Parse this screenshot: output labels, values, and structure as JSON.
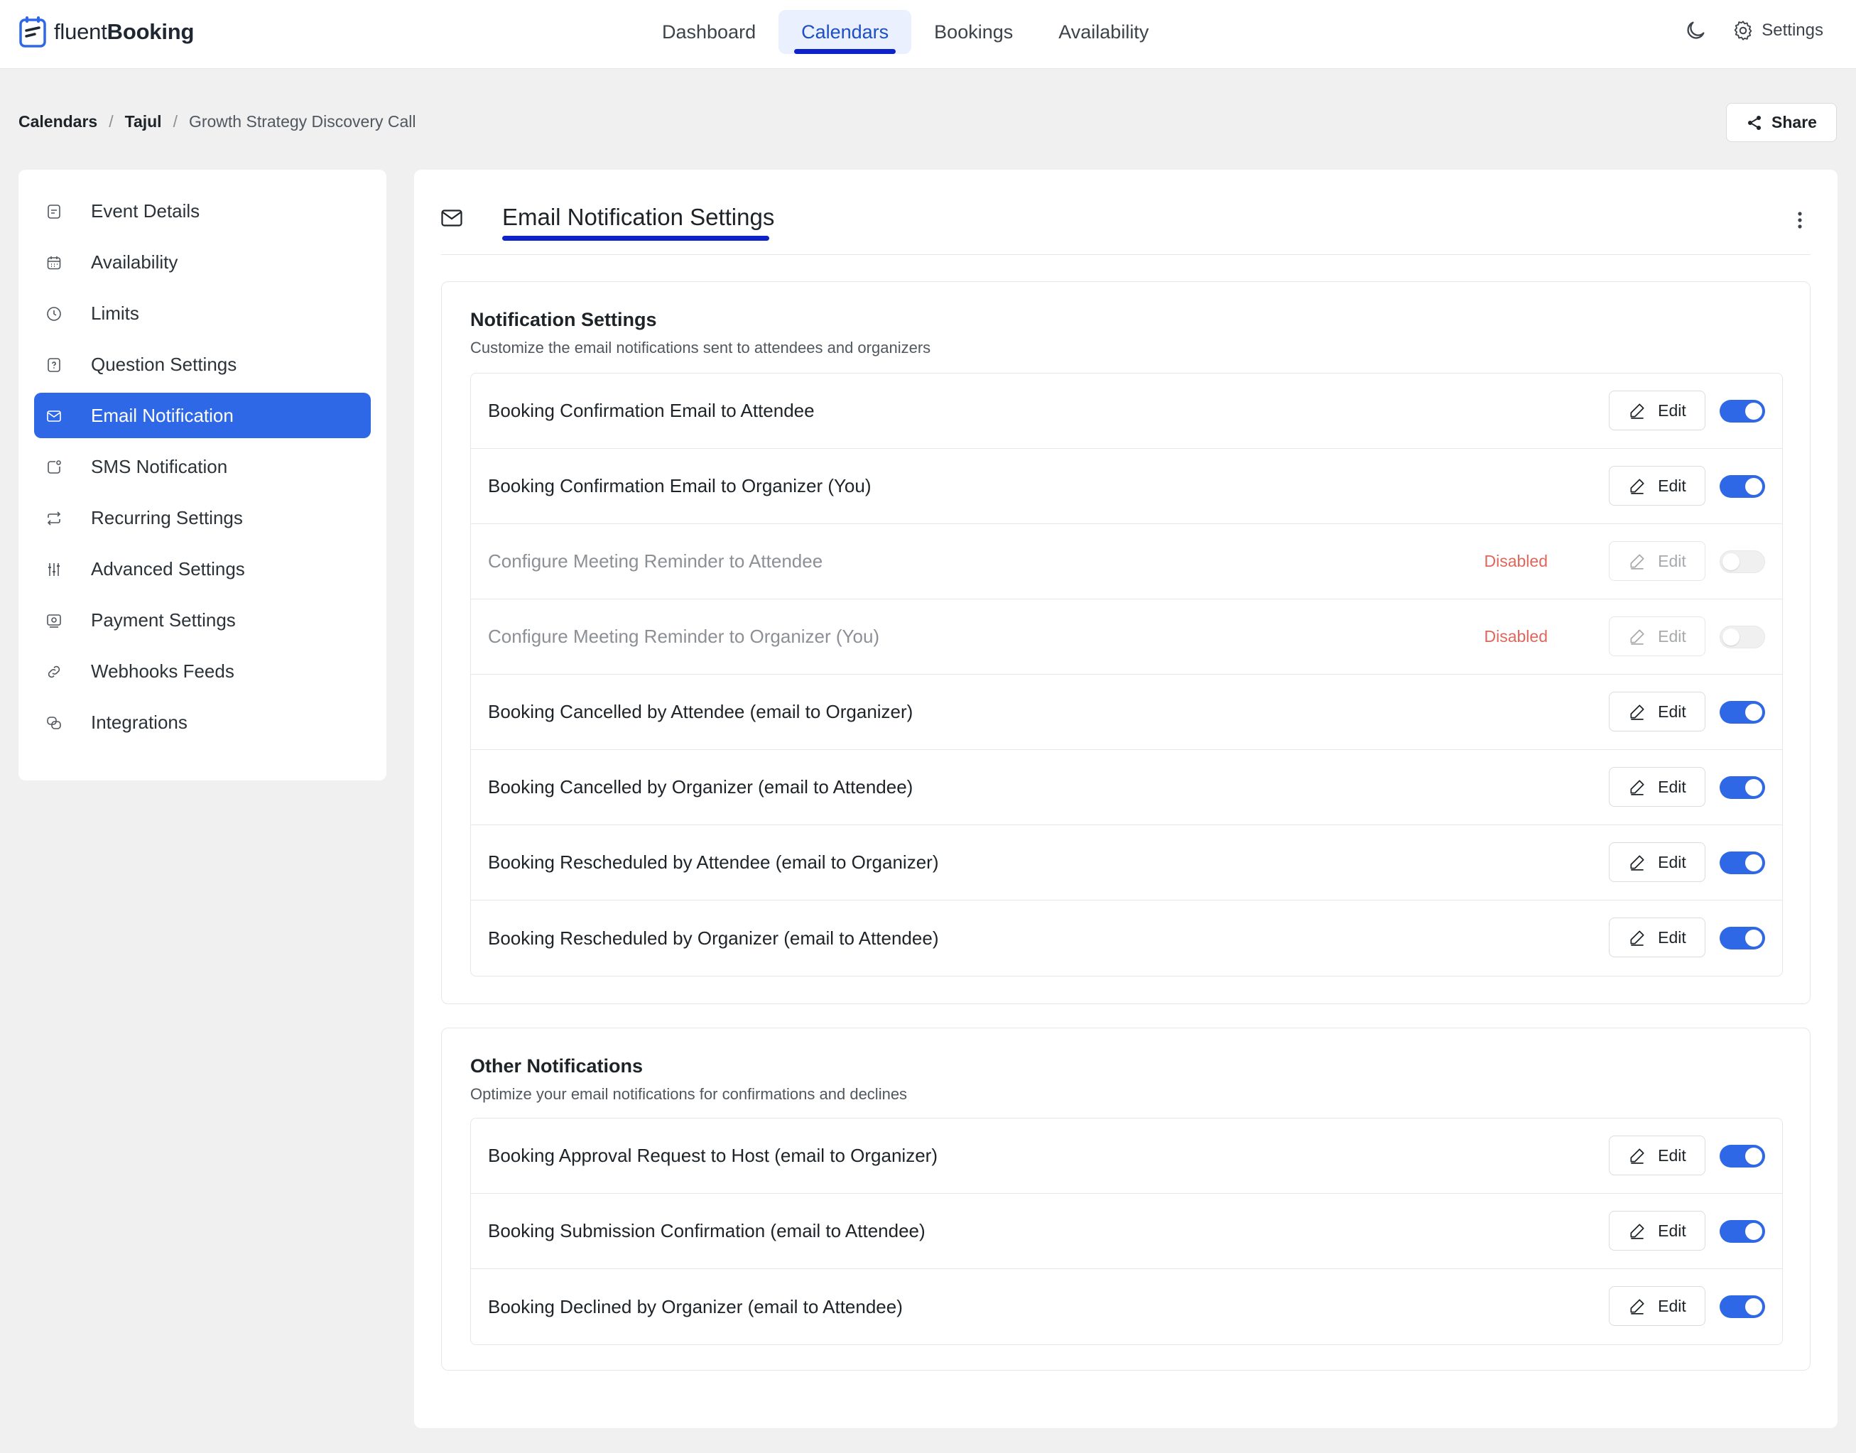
{
  "brand": {
    "light": "fluent",
    "bold": "Booking"
  },
  "nav": {
    "items": [
      {
        "label": "Dashboard"
      },
      {
        "label": "Calendars"
      },
      {
        "label": "Bookings"
      },
      {
        "label": "Availability"
      }
    ],
    "active": "Calendars",
    "settings_label": "Settings"
  },
  "breadcrumb": {
    "root": "Calendars",
    "calendar": "Tajul",
    "event": "Growth Strategy Discovery Call"
  },
  "share_label": "Share",
  "sidebar": {
    "items": [
      {
        "label": "Event Details",
        "icon": "document-icon"
      },
      {
        "label": "Availability",
        "icon": "calendar-icon"
      },
      {
        "label": "Limits",
        "icon": "clock-icon"
      },
      {
        "label": "Question Settings",
        "icon": "question-icon"
      },
      {
        "label": "Email Notification",
        "icon": "envelope-icon"
      },
      {
        "label": "SMS Notification",
        "icon": "sms-icon"
      },
      {
        "label": "Recurring Settings",
        "icon": "repeat-icon"
      },
      {
        "label": "Advanced Settings",
        "icon": "sliders-icon"
      },
      {
        "label": "Payment Settings",
        "icon": "payment-icon"
      },
      {
        "label": "Webhooks Feeds",
        "icon": "link-icon"
      },
      {
        "label": "Integrations",
        "icon": "integrations-icon"
      }
    ],
    "active": "Email Notification"
  },
  "main": {
    "title": "Email Notification Settings",
    "notification_settings": {
      "title": "Notification Settings",
      "subtitle": "Customize the email notifications sent to attendees and organizers",
      "rows": [
        {
          "label": "Booking Confirmation Email to Attendee",
          "enabled": true,
          "edit": "Edit"
        },
        {
          "label": "Booking Confirmation Email to Organizer (You)",
          "enabled": true,
          "edit": "Edit"
        },
        {
          "label": "Configure Meeting Reminder to Attendee",
          "enabled": false,
          "status": "Disabled",
          "edit": "Edit"
        },
        {
          "label": "Configure Meeting Reminder to Organizer (You)",
          "enabled": false,
          "status": "Disabled",
          "edit": "Edit"
        },
        {
          "label": "Booking Cancelled by Attendee (email to Organizer)",
          "enabled": true,
          "edit": "Edit"
        },
        {
          "label": "Booking Cancelled by Organizer (email to Attendee)",
          "enabled": true,
          "edit": "Edit"
        },
        {
          "label": "Booking Rescheduled by Attendee (email to Organizer)",
          "enabled": true,
          "edit": "Edit"
        },
        {
          "label": "Booking Rescheduled by Organizer (email to Attendee)",
          "enabled": true,
          "edit": "Edit"
        }
      ]
    },
    "other_notifications": {
      "title": "Other Notifications",
      "subtitle": "Optimize your email notifications for confirmations and declines",
      "rows": [
        {
          "label": "Booking Approval Request to Host (email to Organizer)",
          "enabled": true,
          "edit": "Edit"
        },
        {
          "label": "Booking Submission Confirmation (email to Attendee)",
          "enabled": true,
          "edit": "Edit"
        },
        {
          "label": "Booking Declined by Organizer (email to Attendee)",
          "enabled": true,
          "edit": "Edit"
        }
      ]
    }
  },
  "colors": {
    "accent": "#2f68e6",
    "underline": "#0e22c9",
    "disabled_text": "#e0665c",
    "page_bg": "#f0f0f1"
  }
}
